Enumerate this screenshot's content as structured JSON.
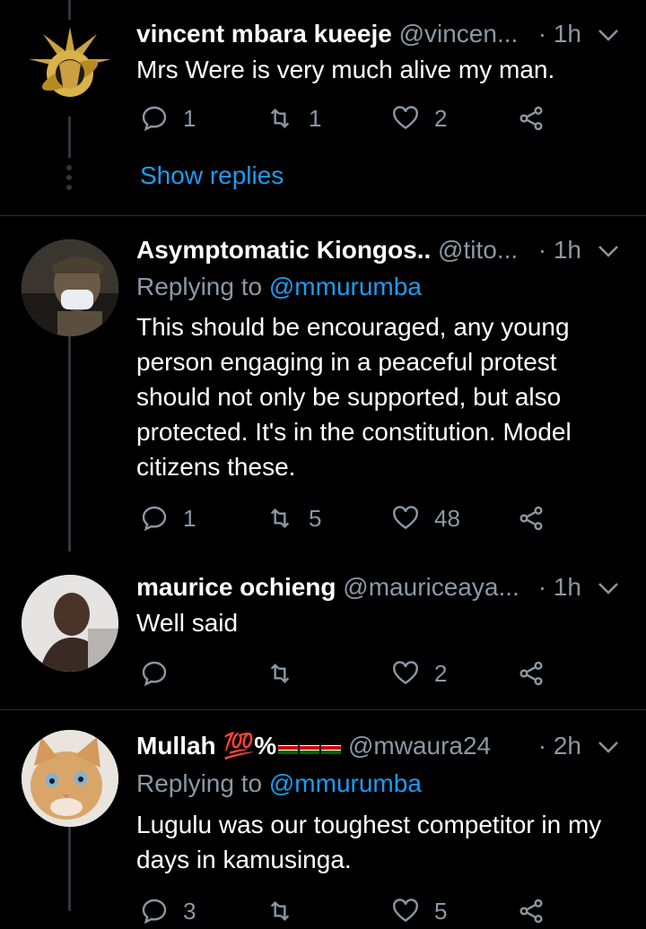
{
  "tweets": [
    {
      "name": "vincent mbara kueeje",
      "handle": "@vincen...",
      "time": "· 1h",
      "text": "Mrs Were is very much alive my man.",
      "replies": "1",
      "retweets": "1",
      "likes": "2",
      "show_replies": "Show replies"
    },
    {
      "name": "Asymptomatic Kiongos..",
      "handle": "@tito...",
      "time": "· 1h",
      "replying_label": "Replying to",
      "replying_to": "@mmurumba",
      "text": "This should be encouraged, any young person engaging in a peaceful protest should not only be supported, but also protected. It's in the constitution. Model citizens these.",
      "replies": "1",
      "retweets": "5",
      "likes": "48"
    },
    {
      "name": "maurice ochieng",
      "handle": "@mauriceaya...",
      "time": "· 1h",
      "text": "Well said",
      "replies": "",
      "retweets": "",
      "likes": "2"
    },
    {
      "name": "Mullah 💯%",
      "handle": "@mwaura24",
      "time": "· 2h",
      "replying_label": "Replying to",
      "replying_to": "@mmurumba",
      "text": "Lugulu was our toughest competitor in my days in kamusinga.",
      "replies": "3",
      "retweets": "",
      "likes": "5"
    }
  ],
  "colors": {
    "background": "#000000",
    "accent": "#1d9bf0",
    "muted": "#8b98a5",
    "divider": "#2f3336"
  },
  "icons": [
    "reply-icon",
    "retweet-icon",
    "like-icon",
    "share-icon",
    "chevron-down-icon"
  ]
}
